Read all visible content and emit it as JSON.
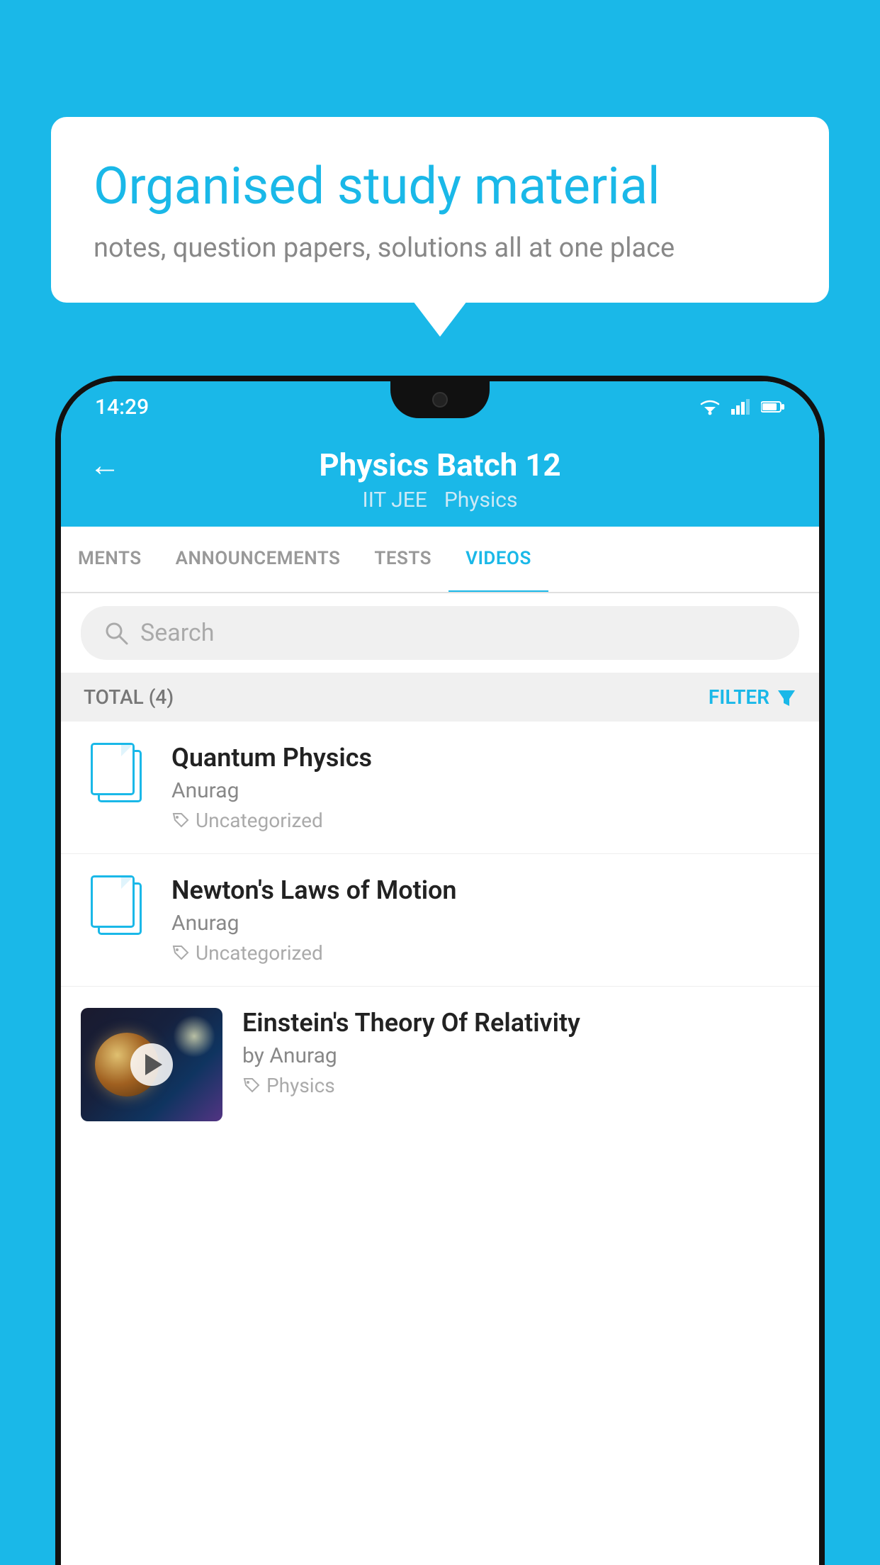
{
  "background_color": "#1ab8e8",
  "bubble": {
    "title": "Organised study material",
    "subtitle": "notes, question papers, solutions all at one place"
  },
  "phone": {
    "status_bar": {
      "time": "14:29",
      "wifi": "wifi-icon",
      "signal": "signal-icon",
      "battery": "battery-icon"
    },
    "header": {
      "back_label": "←",
      "title": "Physics Batch 12",
      "subtitle_course": "IIT JEE",
      "subtitle_subject": "Physics"
    },
    "tabs": [
      {
        "label": "MENTS",
        "active": false
      },
      {
        "label": "ANNOUNCEMENTS",
        "active": false
      },
      {
        "label": "TESTS",
        "active": false
      },
      {
        "label": "VIDEOS",
        "active": true
      }
    ],
    "search": {
      "placeholder": "Search"
    },
    "filter": {
      "total_label": "TOTAL (4)",
      "filter_label": "FILTER"
    },
    "videos": [
      {
        "id": 1,
        "title": "Quantum Physics",
        "author": "Anurag",
        "tag": "Uncategorized",
        "has_thumbnail": false
      },
      {
        "id": 2,
        "title": "Newton's Laws of Motion",
        "author": "Anurag",
        "tag": "Uncategorized",
        "has_thumbnail": false
      },
      {
        "id": 3,
        "title": "Einstein's Theory Of Relativity",
        "author": "by Anurag",
        "tag": "Physics",
        "has_thumbnail": true
      }
    ]
  }
}
